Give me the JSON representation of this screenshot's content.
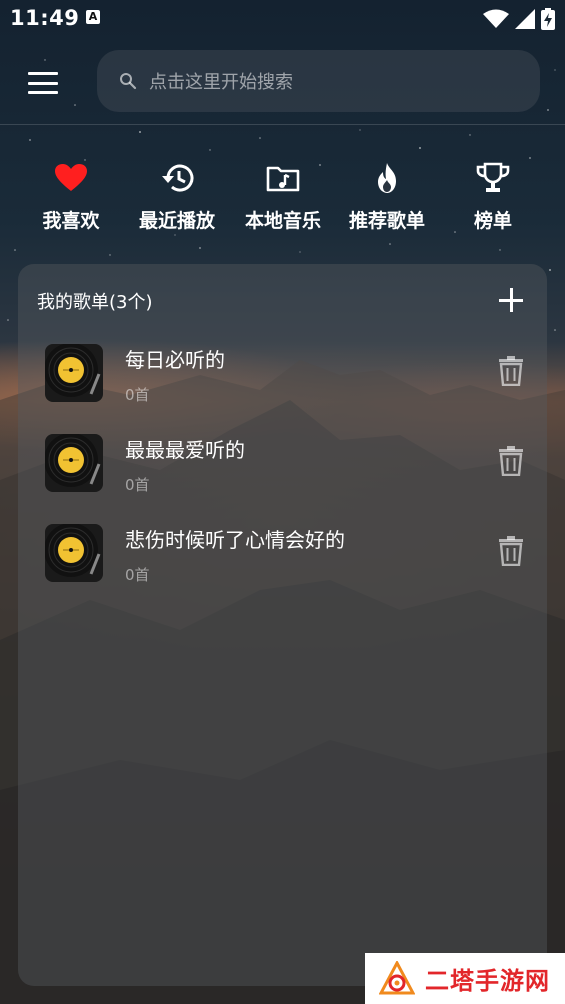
{
  "status_bar": {
    "time": "11:49",
    "notification_icon": "A"
  },
  "header": {
    "menu_icon": "hamburger-menu",
    "search": {
      "placeholder": "点击这里开始搜索",
      "icon": "search-icon"
    }
  },
  "quick_nav": [
    {
      "label": "我喜欢",
      "icon": "heart-icon",
      "color": "#ff1f1f"
    },
    {
      "label": "最近播放",
      "icon": "history-icon",
      "color": "#ffffff"
    },
    {
      "label": "本地音乐",
      "icon": "music-folder-icon",
      "color": "#ffffff"
    },
    {
      "label": "推荐歌单",
      "icon": "flame-icon",
      "color": "#ffffff"
    },
    {
      "label": "榜单",
      "icon": "trophy-icon",
      "color": "#ffffff"
    }
  ],
  "my_playlists": {
    "title": "我的歌单(3个)",
    "items": [
      {
        "name": "每日必听的",
        "count": "0首"
      },
      {
        "name": "最最最爱听的",
        "count": "0首"
      },
      {
        "name": "悲伤时候听了心情会好的",
        "count": "0首"
      }
    ]
  },
  "watermark": {
    "text": "二塔手游网"
  }
}
